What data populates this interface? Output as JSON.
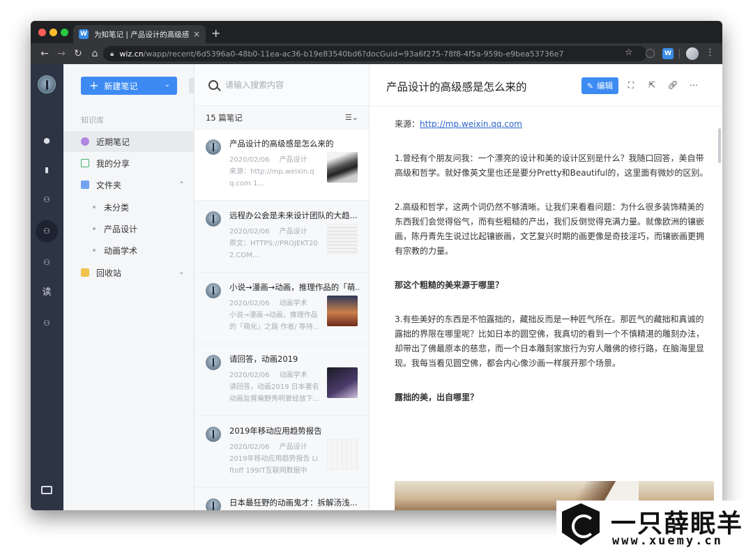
{
  "browser": {
    "tab_title": "为知笔记 | 产品设计的高级感是怎么来的",
    "tab_favicon": "W",
    "new_tab": "+",
    "tab_close": "×",
    "url_host": "wiz.cn",
    "url_path": "/wapp/recent/6d5396a0-48b0-11ea-ac36-b19e83540bd6?docGuid=93a6f275-78f8-4f5a-959b-e9bea53736e7",
    "back": "←",
    "forward": "→",
    "reload": "↻",
    "home": "⌂",
    "star": "☆",
    "menu": "⋮",
    "ext_label": "W"
  },
  "rail": {
    "icons": [
      "bell-icon",
      "document-icon",
      "group-icon",
      "group-icon",
      "group-icon",
      "read-icon",
      "group-icon",
      "screen-icon"
    ],
    "read_label": "读"
  },
  "sidebar": {
    "new_note": "新建笔记",
    "section_label": "知识库",
    "items": [
      {
        "label": "近期笔记"
      },
      {
        "label": "我的分享"
      },
      {
        "label": "文件夹"
      },
      {
        "label": "回收站"
      }
    ],
    "folders": [
      {
        "label": "未分类"
      },
      {
        "label": "产品设计"
      },
      {
        "label": "动画学术"
      }
    ]
  },
  "notelist": {
    "search_placeholder": "请输入搜索内容",
    "count": "15 篇笔记",
    "notes": [
      {
        "title": "产品设计的高级感是怎么来的",
        "date": "2020/02/06",
        "category": "产品设计",
        "preview": "来源：http://mp.weixin.qq.com 1...",
        "thumb": "thumb-man"
      },
      {
        "title": "远程办公会是未来设计团队的大趋...",
        "date": "2020/02/06",
        "category": "产品设计",
        "preview": "原文：HTTPS://PROJEKT202.COM...",
        "thumb": "thumb-doc"
      },
      {
        "title": "小说→漫画→动画，推理作品的「萌...",
        "date": "2020/02/06",
        "category": "动画学术",
        "preview": "小说→漫画→动画，推理作品的「萌化」之路 作者/ 等待...",
        "thumb": "thumb-anime"
      },
      {
        "title": "请回答，动画2019",
        "date": "2020/02/06",
        "category": "动画学术",
        "preview": "请回答，动画2019 日本著名动画监督庵野秀明曾经放下...",
        "thumb": "thumb-dark"
      },
      {
        "title": "2019年移动应用趋势报告",
        "date": "2020/02/06",
        "category": "产品设计",
        "preview": "2019年移动应用趋势报告 Liftoff 199IT互联网数据中心...",
        "thumb": "thumb-chart"
      },
      {
        "title": "日本最狂野的动画鬼才：拆解汤浅...",
        "date": "",
        "category": "",
        "preview": "",
        "thumb": ""
      }
    ]
  },
  "content": {
    "title": "产品设计的高级感是怎么来的",
    "edit_label": "编辑",
    "source_label": "来源：",
    "source_link": "http://mp.weixin.qq.com",
    "p1": "1.曾经有个朋友问我：一个漂亮的设计和美的设计区别是什么？我随口回答，美自带高级和哲学。就好像英文里也还是要分Pretty和Beautiful的，这里面有微妙的区别。",
    "p2": "2.高级和哲学，这两个词仍然不够清晰。让我们来看看问题：为什么很多装饰精美的东西我们会觉得俗气，而有些粗糙的产出，我们反倒觉得充满力量。就像欧洲的镶嵌画，陈丹青先生说过比起镶嵌画，文艺复兴时期的画更像是奇技淫巧，而镶嵌画更拥有宗教的力量。",
    "h1": "那这个粗糙的美来源于哪里？",
    "p3": "3.有些美好的东西是不怕露拙的，藏拙反而是一种匠气所在。那匠气的藏拙和真诚的露拙的界限在哪里呢？比如日本的圆空佛，我真切的看到一个不慎精湛的雕刻办法，却带出了佛最原本的慈悲，而一个日本雕刻家旅行为穷人雕佛的修行路，在脑海里显现。我每当看见圆空佛，都会内心像沙画一样展开那个场景。",
    "h2": "露拙的美，出自哪里？"
  },
  "watermark": {
    "cn": "一只薛眠羊",
    "en": "www.xuemy.cn"
  }
}
